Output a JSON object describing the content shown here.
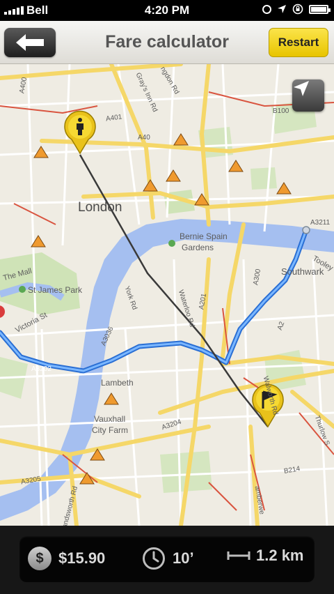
{
  "status_bar": {
    "carrier": "Bell",
    "time": "4:20 PM"
  },
  "nav": {
    "title": "Fare calculator",
    "restart_label": "Restart"
  },
  "map": {
    "labels": {
      "london": "London",
      "bernie": "Bernie Spain",
      "gardens": "Gardens",
      "southwark": "Southwark",
      "st_james": "St James Park",
      "the_mall": "The Mall",
      "victoria": "Victoria St",
      "lambeth": "Lambeth",
      "vauxhall": "Vauxhall",
      "city_farm": "City Farm",
      "york_rd": "York Rd",
      "waterloo_rd": "Waterloo Rd",
      "a201": "A201",
      "a300": "A300",
      "a3036": "A3036",
      "a3204": "A3204",
      "a3205": "A3205",
      "a40": "A40",
      "a401": "A401",
      "a400": "A400",
      "b100": "B100",
      "a3211": "A3211",
      "b214": "B214",
      "a2": "A2",
      "a3202": "A3202",
      "tooley": "Tooley",
      "grays": "Gray's Inn Rd",
      "kingdon": "ngdon Rd",
      "walworth": "Walworth Rd",
      "thurlow": "Thurlow S",
      "camberwell": "amberwe",
      "wandsworth": "andsworth Rd"
    }
  },
  "trip": {
    "fare": "$15.90",
    "duration": "10’",
    "distance": "1.2 km"
  }
}
